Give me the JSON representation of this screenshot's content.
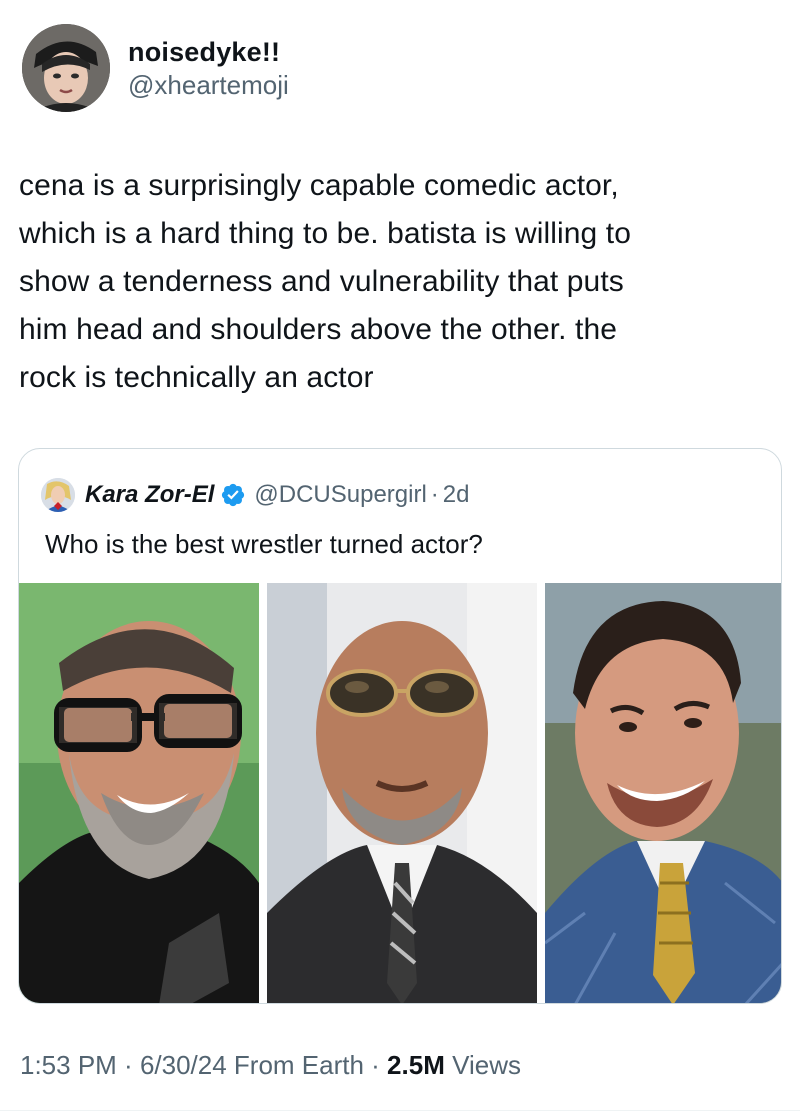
{
  "author": {
    "display_name": "noisedyke!!",
    "handle": "@xheartemoji"
  },
  "tweet": {
    "lines": [
      "cena is a surprisingly capable comedic actor,",
      "which is a hard thing to be. batista is willing to",
      "show a tenderness and vulnerability that puts",
      "him head and shoulders above the other. the",
      "rock is technically an actor"
    ]
  },
  "quoted_tweet": {
    "display_name": "Kara Zor-El",
    "handle": "@DCUSupergirl",
    "separator": "·",
    "time": "2d",
    "text": "Who is the best wrestler turned actor?",
    "verified_icon": "verified-badge-icon",
    "photos": [
      "photo-bald-bearded-man-black-glasses",
      "photo-bald-man-sunglasses-suit",
      "photo-smiling-man-blue-suit"
    ]
  },
  "meta": {
    "time": "1:53 PM",
    "sep1": " · ",
    "date": "6/30/24",
    "source": " From Earth",
    "sep2": " · ",
    "views_count": "2.5M",
    "views_label": " Views"
  },
  "colors": {
    "text": "#0f1419",
    "secondary": "#536471",
    "border": "#cfd9de",
    "verified": "#1d9bf0"
  }
}
